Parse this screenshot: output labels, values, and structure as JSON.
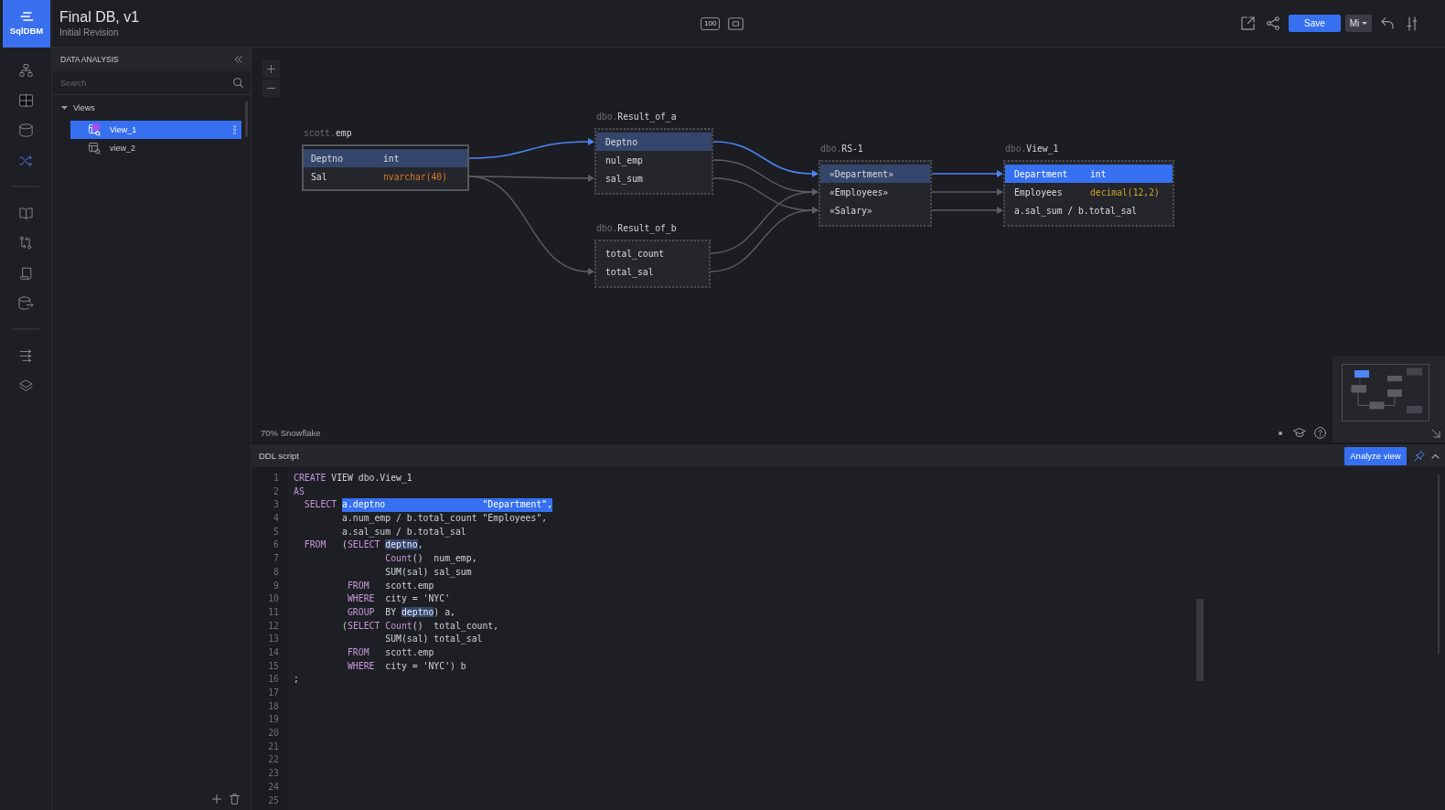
{
  "logo": {
    "label": "SqlDBM"
  },
  "header": {
    "title": "Final DB, v1",
    "subtitle": "Initial Revision",
    "zoom_button": "100",
    "save_button": "Save",
    "user_button": "Mi"
  },
  "rail": {
    "groups": [
      [
        {
          "selected": false
        },
        {
          "selected": false
        },
        {
          "selected": false
        },
        {
          "selected": true
        }
      ],
      [
        {
          "selected": false
        },
        {
          "selected": false
        },
        {
          "selected": false
        },
        {
          "selected": false
        }
      ],
      [
        {
          "selected": false
        },
        {
          "selected": false
        }
      ]
    ]
  },
  "sidebar": {
    "title": "DATA ANALYSIS",
    "search": {
      "placeholder": "Search"
    },
    "tree": [
      {
        "label": "Views",
        "expanded": true,
        "selected": false,
        "children": [
          {
            "label": "View_1",
            "selected": true,
            "flagged": true
          },
          {
            "label": "view_2",
            "selected": false,
            "flagged": false
          }
        ]
      }
    ]
  },
  "canvas": {
    "tables": [
      {
        "schema": "scott.",
        "name": "emp",
        "kind": "table",
        "rows": [
          {
            "name": "Deptno",
            "type": "int",
            "selected": false,
            "highlighted": true
          },
          {
            "name": "Sal",
            "type": "nvarchar(40)",
            "color": "#dd7a2c",
            "selected": false,
            "highlighted": false
          }
        ]
      },
      {
        "schema": "dbo.",
        "name": "Result_of_a",
        "kind": "query",
        "rows": [
          {
            "name": "Deptno",
            "selected": false,
            "highlighted": true
          },
          {
            "name": "nul_emp",
            "selected": false,
            "highlighted": false
          },
          {
            "name": "sal_sum",
            "selected": false,
            "highlighted": false
          }
        ]
      },
      {
        "schema": "dbo.",
        "name": "Result_of_b",
        "kind": "query",
        "rows": [
          {
            "name": "total_count",
            "selected": false,
            "highlighted": false
          },
          {
            "name": "total_sal",
            "selected": false,
            "highlighted": false
          }
        ]
      },
      {
        "schema": "dbo.",
        "name": "RS-1",
        "kind": "query",
        "rows": [
          {
            "name": "«Department»",
            "selected": false,
            "highlighted": true
          },
          {
            "name": "«Employees»",
            "selected": false,
            "highlighted": false
          },
          {
            "name": "«Salary»",
            "selected": false,
            "highlighted": false
          }
        ]
      },
      {
        "schema": "dbo.",
        "name": "View_1",
        "kind": "query",
        "rows": [
          {
            "name": "Department",
            "type": "int",
            "selected": true,
            "highlighted": false
          },
          {
            "name": "Employees",
            "type": "decimal(12,2)",
            "color": "#c9a52e",
            "selected": false,
            "highlighted": false
          },
          {
            "name": "a.sal_sum / b.total_sal",
            "selected": false,
            "highlighted": false
          }
        ]
      }
    ],
    "status": "70% Snowflake"
  },
  "ddl": {
    "title": "DDL script",
    "analyze_button": "Analyze view",
    "lines": [
      {
        "number": "1",
        "tokens": [
          {
            "text": "CREATE",
            "kind": "keyword"
          },
          {
            "text": " VIEW dbo.View_1",
            "kind": "plain"
          }
        ]
      },
      {
        "number": "2",
        "tokens": [
          {
            "text": "AS",
            "kind": "keyword"
          }
        ]
      },
      {
        "number": "3",
        "tokens": [
          {
            "text": "  SELECT ",
            "kind": "keyword"
          },
          {
            "text": "a.deptno                  \"Department\",",
            "kind": "selection"
          }
        ]
      },
      {
        "number": "4",
        "tokens": [
          {
            "text": "         a.num_emp / b.total_count \"Employees\",",
            "kind": "plain"
          }
        ]
      },
      {
        "number": "5",
        "tokens": [
          {
            "text": "         a.sal_sum / b.total_sal",
            "kind": "plain"
          }
        ]
      },
      {
        "number": "6",
        "tokens": [
          {
            "text": "  FROM",
            "kind": "keyword"
          },
          {
            "text": "   (",
            "kind": "plain"
          },
          {
            "text": "SELECT ",
            "kind": "keyword"
          },
          {
            "text": "deptno",
            "kind": "match"
          },
          {
            "text": ",",
            "kind": "plain"
          }
        ]
      },
      {
        "number": "7",
        "tokens": [
          {
            "text": "                 Count",
            "kind": "keyword"
          },
          {
            "text": "()  num_emp,",
            "kind": "plain"
          }
        ]
      },
      {
        "number": "8",
        "tokens": [
          {
            "text": "                 SUM(sal) sal_sum",
            "kind": "plain"
          }
        ]
      },
      {
        "number": "9",
        "tokens": [
          {
            "text": "          FROM",
            "kind": "keyword"
          },
          {
            "text": "   scott.emp",
            "kind": "plain"
          }
        ]
      },
      {
        "number": "10",
        "tokens": [
          {
            "text": "          WHERE",
            "kind": "keyword"
          },
          {
            "text": "  city = 'NYC'",
            "kind": "plain"
          }
        ]
      },
      {
        "number": "11",
        "tokens": [
          {
            "text": "          GROUP",
            "kind": "keyword"
          },
          {
            "text": "  BY ",
            "kind": "plain"
          },
          {
            "text": "deptno",
            "kind": "match"
          },
          {
            "text": ") a,",
            "kind": "plain"
          }
        ]
      },
      {
        "number": "12",
        "tokens": [
          {
            "text": "         (",
            "kind": "plain"
          },
          {
            "text": "SELECT Count",
            "kind": "keyword"
          },
          {
            "text": "()  total_count,",
            "kind": "plain"
          }
        ]
      },
      {
        "number": "13",
        "tokens": [
          {
            "text": "                 SUM(sal) total_sal",
            "kind": "plain"
          }
        ]
      },
      {
        "number": "14",
        "tokens": [
          {
            "text": "          FROM",
            "kind": "keyword"
          },
          {
            "text": "   scott.emp",
            "kind": "plain"
          }
        ]
      },
      {
        "number": "15",
        "tokens": [
          {
            "text": "          WHERE",
            "kind": "keyword"
          },
          {
            "text": "  city = 'NYC') b",
            "kind": "plain"
          }
        ]
      },
      {
        "number": "16",
        "tokens": [
          {
            "text": ";",
            "kind": "plain"
          }
        ]
      },
      {
        "number": "17"
      },
      {
        "number": "18"
      },
      {
        "number": "19"
      },
      {
        "number": "20"
      },
      {
        "number": "21"
      },
      {
        "number": "22"
      },
      {
        "number": "23"
      },
      {
        "number": "24"
      },
      {
        "number": "25"
      }
    ]
  }
}
